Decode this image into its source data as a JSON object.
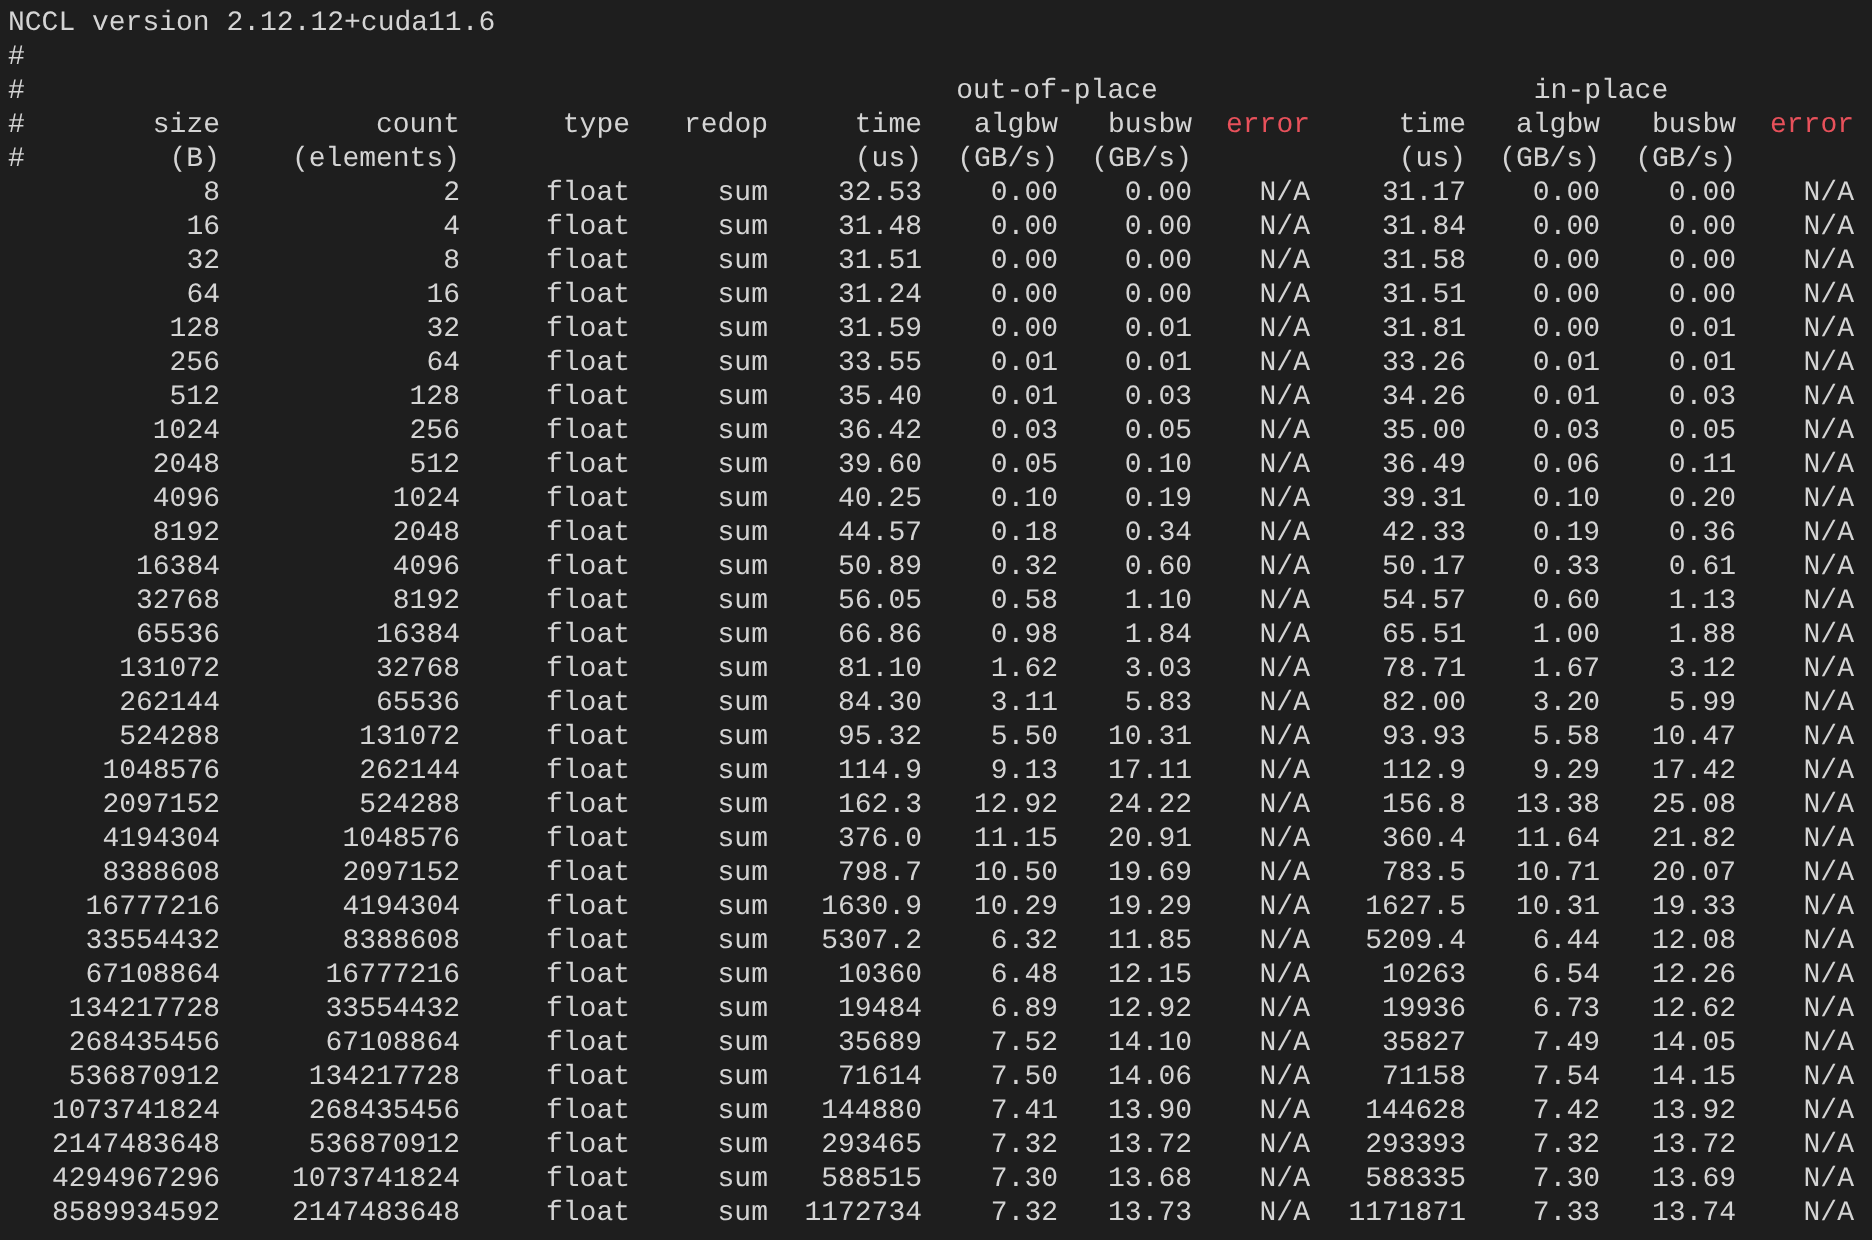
{
  "version_line": "NCCL version 2.12.12+cuda11.6",
  "comment_lines": [
    "#"
  ],
  "header": {
    "prefixes": [
      "#",
      "#",
      "#"
    ],
    "groups": [
      {
        "label": "out-of-place"
      },
      {
        "label": "in-place"
      }
    ],
    "columns": [
      {
        "label": "size",
        "unit": "(B)",
        "kind": "normal"
      },
      {
        "label": "count",
        "unit": "(elements)",
        "kind": "normal"
      },
      {
        "label": "type",
        "kind": "normal"
      },
      {
        "label": "redop",
        "kind": "normal"
      },
      {
        "label": "time",
        "unit": "(us)",
        "kind": "normal"
      },
      {
        "label": "algbw",
        "unit": "(GB/s)",
        "kind": "normal"
      },
      {
        "label": "busbw",
        "unit": "(GB/s)",
        "kind": "normal"
      },
      {
        "label": "error",
        "kind": "error"
      },
      {
        "label": "time",
        "unit": "(us)",
        "kind": "normal"
      },
      {
        "label": "algbw",
        "unit": "(GB/s)",
        "kind": "normal"
      },
      {
        "label": "busbw",
        "unit": "(GB/s)",
        "kind": "normal"
      },
      {
        "label": "error",
        "kind": "error"
      }
    ]
  },
  "rows": [
    [
      "8",
      "2",
      "float",
      "sum",
      "32.53",
      "0.00",
      "0.00",
      "N/A",
      "31.17",
      "0.00",
      "0.00",
      "N/A"
    ],
    [
      "16",
      "4",
      "float",
      "sum",
      "31.48",
      "0.00",
      "0.00",
      "N/A",
      "31.84",
      "0.00",
      "0.00",
      "N/A"
    ],
    [
      "32",
      "8",
      "float",
      "sum",
      "31.51",
      "0.00",
      "0.00",
      "N/A",
      "31.58",
      "0.00",
      "0.00",
      "N/A"
    ],
    [
      "64",
      "16",
      "float",
      "sum",
      "31.24",
      "0.00",
      "0.00",
      "N/A",
      "31.51",
      "0.00",
      "0.00",
      "N/A"
    ],
    [
      "128",
      "32",
      "float",
      "sum",
      "31.59",
      "0.00",
      "0.01",
      "N/A",
      "31.81",
      "0.00",
      "0.01",
      "N/A"
    ],
    [
      "256",
      "64",
      "float",
      "sum",
      "33.55",
      "0.01",
      "0.01",
      "N/A",
      "33.26",
      "0.01",
      "0.01",
      "N/A"
    ],
    [
      "512",
      "128",
      "float",
      "sum",
      "35.40",
      "0.01",
      "0.03",
      "N/A",
      "34.26",
      "0.01",
      "0.03",
      "N/A"
    ],
    [
      "1024",
      "256",
      "float",
      "sum",
      "36.42",
      "0.03",
      "0.05",
      "N/A",
      "35.00",
      "0.03",
      "0.05",
      "N/A"
    ],
    [
      "2048",
      "512",
      "float",
      "sum",
      "39.60",
      "0.05",
      "0.10",
      "N/A",
      "36.49",
      "0.06",
      "0.11",
      "N/A"
    ],
    [
      "4096",
      "1024",
      "float",
      "sum",
      "40.25",
      "0.10",
      "0.19",
      "N/A",
      "39.31",
      "0.10",
      "0.20",
      "N/A"
    ],
    [
      "8192",
      "2048",
      "float",
      "sum",
      "44.57",
      "0.18",
      "0.34",
      "N/A",
      "42.33",
      "0.19",
      "0.36",
      "N/A"
    ],
    [
      "16384",
      "4096",
      "float",
      "sum",
      "50.89",
      "0.32",
      "0.60",
      "N/A",
      "50.17",
      "0.33",
      "0.61",
      "N/A"
    ],
    [
      "32768",
      "8192",
      "float",
      "sum",
      "56.05",
      "0.58",
      "1.10",
      "N/A",
      "54.57",
      "0.60",
      "1.13",
      "N/A"
    ],
    [
      "65536",
      "16384",
      "float",
      "sum",
      "66.86",
      "0.98",
      "1.84",
      "N/A",
      "65.51",
      "1.00",
      "1.88",
      "N/A"
    ],
    [
      "131072",
      "32768",
      "float",
      "sum",
      "81.10",
      "1.62",
      "3.03",
      "N/A",
      "78.71",
      "1.67",
      "3.12",
      "N/A"
    ],
    [
      "262144",
      "65536",
      "float",
      "sum",
      "84.30",
      "3.11",
      "5.83",
      "N/A",
      "82.00",
      "3.20",
      "5.99",
      "N/A"
    ],
    [
      "524288",
      "131072",
      "float",
      "sum",
      "95.32",
      "5.50",
      "10.31",
      "N/A",
      "93.93",
      "5.58",
      "10.47",
      "N/A"
    ],
    [
      "1048576",
      "262144",
      "float",
      "sum",
      "114.9",
      "9.13",
      "17.11",
      "N/A",
      "112.9",
      "9.29",
      "17.42",
      "N/A"
    ],
    [
      "2097152",
      "524288",
      "float",
      "sum",
      "162.3",
      "12.92",
      "24.22",
      "N/A",
      "156.8",
      "13.38",
      "25.08",
      "N/A"
    ],
    [
      "4194304",
      "1048576",
      "float",
      "sum",
      "376.0",
      "11.15",
      "20.91",
      "N/A",
      "360.4",
      "11.64",
      "21.82",
      "N/A"
    ],
    [
      "8388608",
      "2097152",
      "float",
      "sum",
      "798.7",
      "10.50",
      "19.69",
      "N/A",
      "783.5",
      "10.71",
      "20.07",
      "N/A"
    ],
    [
      "16777216",
      "4194304",
      "float",
      "sum",
      "1630.9",
      "10.29",
      "19.29",
      "N/A",
      "1627.5",
      "10.31",
      "19.33",
      "N/A"
    ],
    [
      "33554432",
      "8388608",
      "float",
      "sum",
      "5307.2",
      "6.32",
      "11.85",
      "N/A",
      "5209.4",
      "6.44",
      "12.08",
      "N/A"
    ],
    [
      "67108864",
      "16777216",
      "float",
      "sum",
      "10360",
      "6.48",
      "12.15",
      "N/A",
      "10263",
      "6.54",
      "12.26",
      "N/A"
    ],
    [
      "134217728",
      "33554432",
      "float",
      "sum",
      "19484",
      "6.89",
      "12.92",
      "N/A",
      "19936",
      "6.73",
      "12.62",
      "N/A"
    ],
    [
      "268435456",
      "67108864",
      "float",
      "sum",
      "35689",
      "7.52",
      "14.10",
      "N/A",
      "35827",
      "7.49",
      "14.05",
      "N/A"
    ],
    [
      "536870912",
      "134217728",
      "float",
      "sum",
      "71614",
      "7.50",
      "14.06",
      "N/A",
      "71158",
      "7.54",
      "14.15",
      "N/A"
    ],
    [
      "1073741824",
      "268435456",
      "float",
      "sum",
      "144880",
      "7.41",
      "13.90",
      "N/A",
      "144628",
      "7.42",
      "13.92",
      "N/A"
    ],
    [
      "2147483648",
      "536870912",
      "float",
      "sum",
      "293465",
      "7.32",
      "13.72",
      "N/A",
      "293393",
      "7.32",
      "13.72",
      "N/A"
    ],
    [
      "4294967296",
      "1073741824",
      "float",
      "sum",
      "588515",
      "7.30",
      "13.68",
      "N/A",
      "588335",
      "7.30",
      "13.69",
      "N/A"
    ],
    [
      "8589934592",
      "2147483648",
      "float",
      "sum",
      "1172734",
      "7.32",
      "13.73",
      "N/A",
      "1171871",
      "7.33",
      "13.74",
      "N/A"
    ]
  ]
}
